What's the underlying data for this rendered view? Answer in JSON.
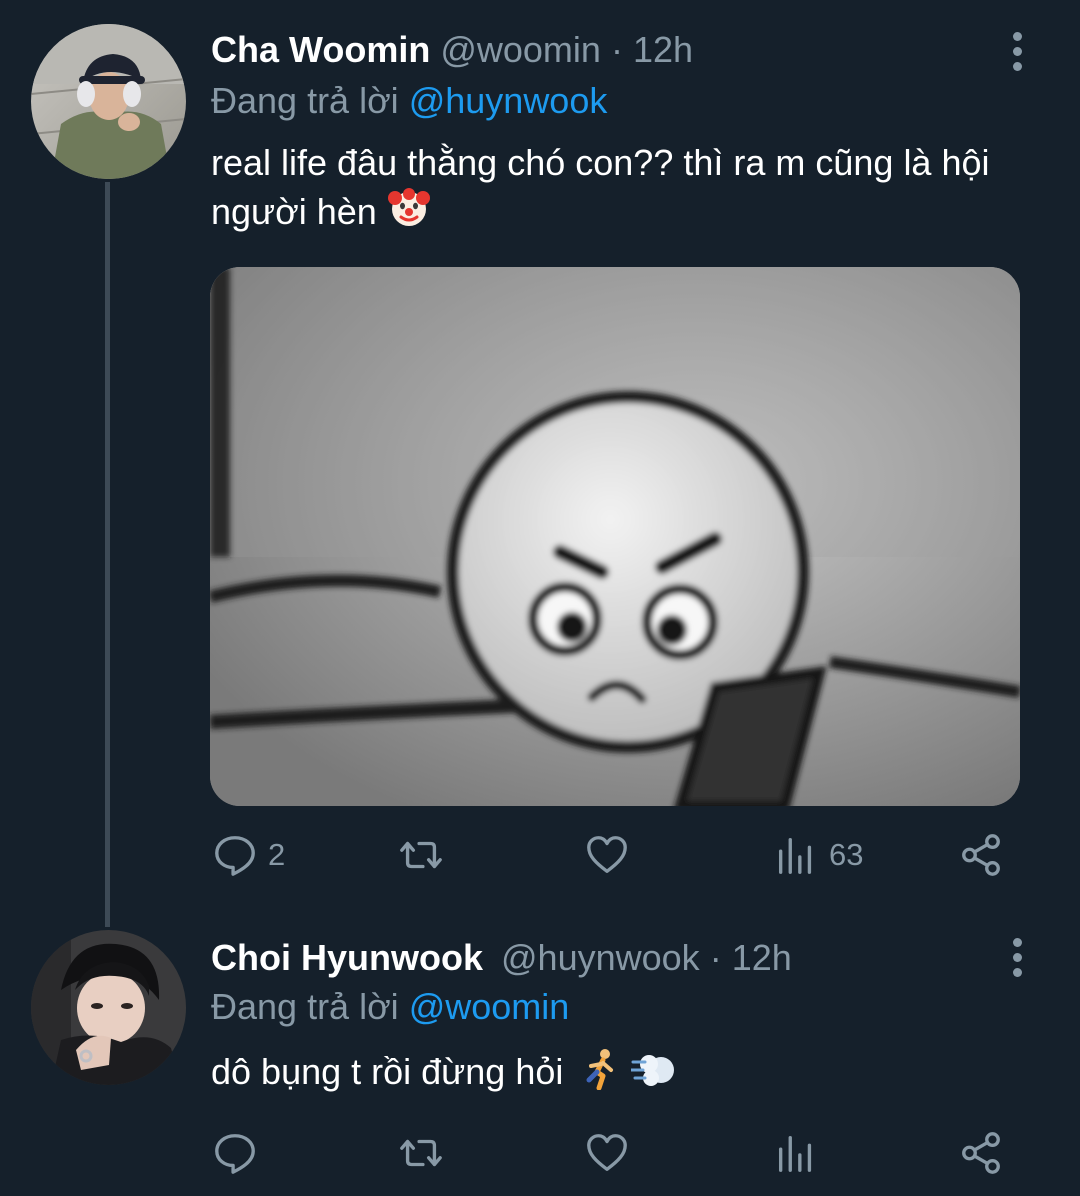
{
  "tweets": [
    {
      "name": "Cha Woomin",
      "handle": "@woomin",
      "separator": "·",
      "time": "12h",
      "reply_prefix": "Đang trả lời",
      "reply_to": "@huynwook",
      "text": "real life đâu thằng chó con?? thì ra m cũng là hội người hèn",
      "text_emoji": "clown-face",
      "has_media": true,
      "stats": {
        "replies": "2",
        "retweets": "",
        "likes": "",
        "views": "63"
      }
    },
    {
      "name": "Choi Hyunwook",
      "handle": "@huynwook",
      "separator": "·",
      "time": "12h",
      "reply_prefix": "Đang trả lời",
      "reply_to": "@woomin",
      "text": "dô bụng t rồi đừng hỏi",
      "text_emoji": "running-person, dash",
      "has_media": false,
      "stats": {
        "replies": "",
        "retweets": "",
        "likes": "",
        "views": ""
      }
    }
  ],
  "colors": {
    "background": "#15202b",
    "text_primary": "#ffffff",
    "text_secondary": "#8899a6",
    "accent": "#1d9bf0",
    "thread_line": "#3d4a56"
  },
  "icons": [
    "more-vertical-icon",
    "reply-icon",
    "retweet-icon",
    "like-icon",
    "views-icon",
    "share-icon"
  ]
}
